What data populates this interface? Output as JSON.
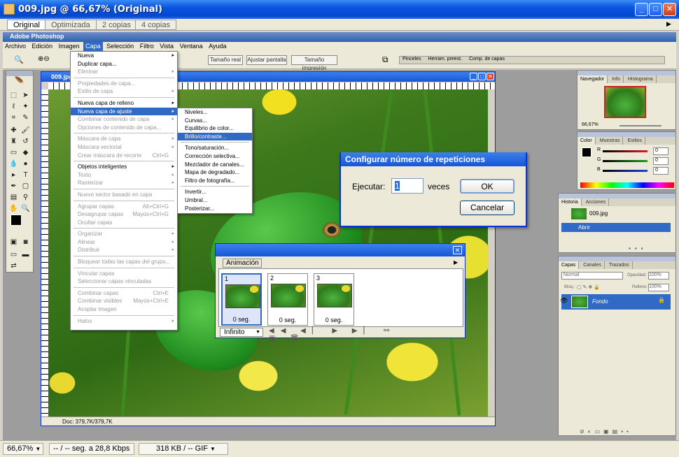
{
  "window": {
    "title": "009.jpg @ 66,67% (Original)",
    "controls": {
      "minimize": "_",
      "maximize": "□",
      "close": "✕"
    }
  },
  "view_tabs": [
    "Original",
    "Optimizada",
    "2 copias",
    "4 copias"
  ],
  "app_title": "Adobe Photoshop",
  "menubar": [
    "Archivo",
    "Edición",
    "Imagen",
    "Capa",
    "Selección",
    "Filtro",
    "Vista",
    "Ventana",
    "Ayuda"
  ],
  "options_bar": {
    "buttons": [
      "Tamaño real",
      "Ajustar pantalla",
      "Tamaño impresión"
    ],
    "palette_well_tabs": [
      "Pinceles",
      "Herram. preest.",
      "Comp. de capas"
    ]
  },
  "document": {
    "title": "009.jpg @ 66,67%",
    "status": "Doc: 379,7K/379,7K"
  },
  "capa_menu": [
    {
      "label": "Nueva",
      "arrow": true
    },
    {
      "label": "Duplicar capa...",
      "disabled": false
    },
    {
      "label": "Eliminar",
      "arrow": true,
      "disabled": true
    },
    {
      "sep": true
    },
    {
      "label": "Propiedades de capa...",
      "disabled": true
    },
    {
      "label": "Estilo de capa",
      "arrow": true,
      "disabled": true
    },
    {
      "sep": true
    },
    {
      "label": "Nueva capa de relleno",
      "arrow": true
    },
    {
      "label": "Nueva capa de ajuste",
      "arrow": true,
      "highlight": true
    },
    {
      "label": "Combinar contenido de capa",
      "arrow": true,
      "disabled": true
    },
    {
      "label": "Opciones de contenido de capa...",
      "disabled": true
    },
    {
      "sep": true
    },
    {
      "label": "Máscara de capa",
      "arrow": true,
      "disabled": true
    },
    {
      "label": "Máscara vectorial",
      "arrow": true,
      "disabled": true
    },
    {
      "label": "Crear máscara de recorte",
      "shortcut": "Ctrl+G",
      "disabled": true
    },
    {
      "sep": true
    },
    {
      "label": "Objetos inteligentes",
      "arrow": true
    },
    {
      "label": "Texto",
      "arrow": true,
      "disabled": true
    },
    {
      "label": "Rasterizar",
      "arrow": true,
      "disabled": true
    },
    {
      "sep": true
    },
    {
      "label": "Nuevo sector basado en capa",
      "disabled": true
    },
    {
      "sep": true
    },
    {
      "label": "Agrupar capas",
      "shortcut": "Alt+Ctrl+G",
      "disabled": true
    },
    {
      "label": "Desagrupar capas",
      "shortcut": "Mayús+Ctrl+G",
      "disabled": true
    },
    {
      "label": "Ocultar capas",
      "disabled": true
    },
    {
      "sep": true
    },
    {
      "label": "Organizar",
      "arrow": true,
      "disabled": true
    },
    {
      "label": "Alinear",
      "arrow": true,
      "disabled": true
    },
    {
      "label": "Distribuir",
      "arrow": true,
      "disabled": true
    },
    {
      "sep": true
    },
    {
      "label": "Bloquear todas las capas del grupo...",
      "disabled": true
    },
    {
      "sep": true
    },
    {
      "label": "Vincular capas",
      "disabled": true
    },
    {
      "label": "Seleccionar capas vinculadas",
      "disabled": true
    },
    {
      "sep": true
    },
    {
      "label": "Combinar capas",
      "shortcut": "Ctrl+E",
      "disabled": true
    },
    {
      "label": "Combinar visibles",
      "shortcut": "Mayús+Ctrl+E",
      "disabled": true
    },
    {
      "label": "Acoplar imagen",
      "disabled": true
    },
    {
      "sep": true
    },
    {
      "label": "Halos",
      "arrow": true,
      "disabled": true
    }
  ],
  "submenu": [
    {
      "label": "Niveles..."
    },
    {
      "label": "Curvas..."
    },
    {
      "label": "Equilibrio de color..."
    },
    {
      "label": "Brillo/contraste...",
      "highlight": true
    },
    {
      "sep": true
    },
    {
      "label": "Tono/saturación..."
    },
    {
      "label": "Corrección selectiva..."
    },
    {
      "label": "Mezclador de canales..."
    },
    {
      "label": "Mapa de degradado..."
    },
    {
      "label": "Filtro de fotografía..."
    },
    {
      "sep": true
    },
    {
      "label": "Invertir..."
    },
    {
      "label": "Umbral..."
    },
    {
      "label": "Posterizar..."
    }
  ],
  "dialog": {
    "title": "Configurar número de repeticiones",
    "label": "Ejecutar:",
    "value": "1",
    "unit": "veces",
    "ok": "OK",
    "cancel": "Cancelar"
  },
  "animation": {
    "tab": "Animación",
    "frames": [
      {
        "num": "1",
        "delay": "0 seg."
      },
      {
        "num": "2",
        "delay": "0 seg."
      },
      {
        "num": "3",
        "delay": "0 seg."
      }
    ],
    "loop": "Infinito"
  },
  "navigator": {
    "tabs": [
      "Navegador",
      "Info",
      "Histograma"
    ],
    "zoom": "66,67%"
  },
  "color_panel": {
    "tabs": [
      "Color",
      "Muestras",
      "Estilos"
    ],
    "channels": [
      {
        "label": "R",
        "value": "0",
        "color": "#e02020"
      },
      {
        "label": "G",
        "value": "0",
        "color": "#20a020"
      },
      {
        "label": "B",
        "value": "0",
        "color": "#2040e0"
      }
    ]
  },
  "history_panel": {
    "tabs": [
      "Historia",
      "Acciones"
    ],
    "items": [
      "009.jpg",
      "Abrir"
    ]
  },
  "layers_panel": {
    "tabs": [
      "Capas",
      "Canales",
      "Trazados"
    ],
    "blend": "Normal",
    "opacity_label": "Opacidad:",
    "opacity": "100%",
    "lock_label": "Bloq.:",
    "fill_label": "Relleno:",
    "fill": "100%",
    "layers": [
      "Fondo"
    ]
  },
  "statusbar": {
    "zoom": "66,67%",
    "speed": "-- / -- seg. a 28,8 Kbps",
    "size": "318 KB / -- GIF"
  }
}
